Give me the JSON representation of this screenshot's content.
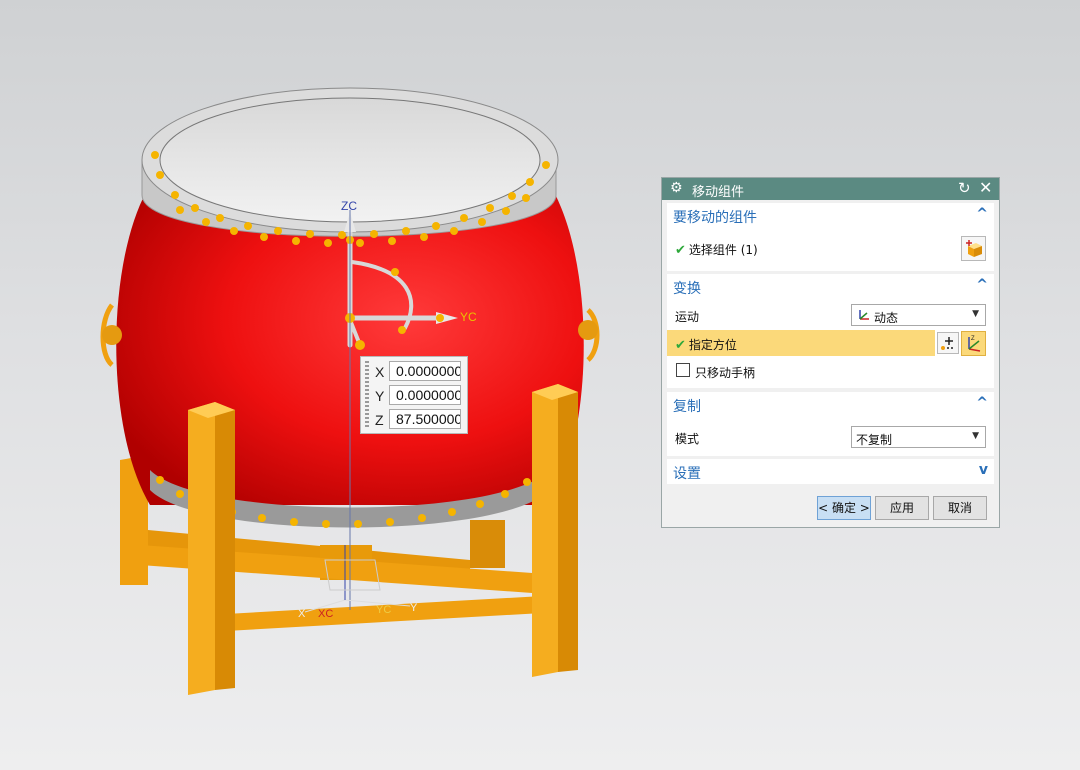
{
  "viewport": {
    "axis_labels": {
      "zc": "ZC",
      "yc": "YC",
      "xc": "XC",
      "x": "X",
      "y": "Y"
    },
    "coords": {
      "x_label": "X",
      "x_value": "0.0000000",
      "y_label": "Y",
      "y_value": "0.0000000",
      "z_label": "Z",
      "z_value": "87.500000"
    },
    "colors": {
      "drum": "#ee1111",
      "stand": "#f0a010",
      "studs": "#f5b400",
      "rim": "#c8c8c8"
    }
  },
  "dialog": {
    "title": "移动组件",
    "sections": {
      "components": {
        "title": "要移动的组件",
        "select_label": "选择组件 (1)"
      },
      "transform": {
        "title": "变换",
        "motion_label": "运动",
        "motion_value": "动态",
        "orient_label": "指定方位",
        "only_handle_label": "只移动手柄"
      },
      "copy": {
        "title": "复制",
        "mode_label": "模式",
        "mode_value": "不复制"
      },
      "settings": {
        "title": "设置"
      }
    },
    "buttons": {
      "ok": "< 确定 >",
      "apply": "应用",
      "cancel": "取消"
    },
    "accent": "#5b8a82",
    "highlight": "#fbd97a"
  }
}
